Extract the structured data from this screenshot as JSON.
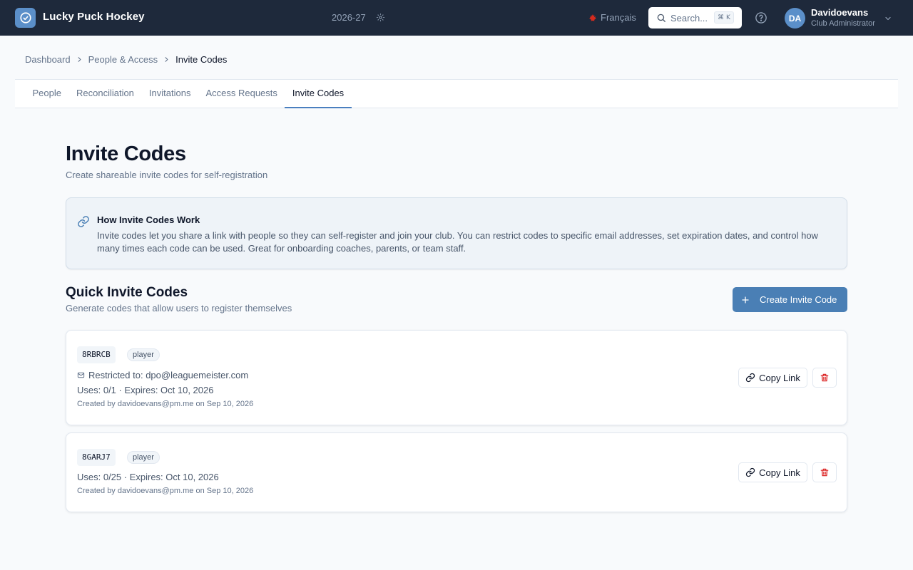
{
  "app": {
    "name": "Lucky Puck Hockey",
    "season": "2026-27"
  },
  "header": {
    "language": "Français",
    "search_placeholder": "Search...",
    "search_shortcut": "⌘ K",
    "user": {
      "initials": "DA",
      "name": "Davidoevans",
      "role": "Club Administrator"
    }
  },
  "breadcrumb": [
    "Dashboard",
    "People & Access",
    "Invite Codes"
  ],
  "tabs": [
    "People",
    "Reconciliation",
    "Invitations",
    "Access Requests",
    "Invite Codes"
  ],
  "page": {
    "title": "Invite Codes",
    "subtitle": "Create shareable invite codes for self-registration"
  },
  "info": {
    "title": "How Invite Codes Work",
    "body": "Invite codes let you share a link with people so they can self-register and join your club. You can restrict codes to specific email addresses, set expiration dates, and control how many times each code can be used. Great for onboarding coaches, parents, or team staff."
  },
  "quick": {
    "title": "Quick Invite Codes",
    "subtitle": "Generate codes that allow users to register themselves",
    "create_label": "Create Invite Code"
  },
  "codes": [
    {
      "code": "8RBRCB",
      "role": "player",
      "restriction": "Restricted to: dpo@leaguemeister.com",
      "uses": "Uses: 0/1 · Expires: Oct 10, 2026",
      "created": "Created by davidoevans@pm.me on Sep 10, 2026",
      "copy_label": "Copy Link"
    },
    {
      "code": "8GARJ7",
      "role": "player",
      "uses": "Uses: 0/25 · Expires: Oct 10, 2026",
      "created": "Created by davidoevans@pm.me on Sep 10, 2026",
      "copy_label": "Copy Link"
    }
  ],
  "colors": {
    "topbar": "#1e293b",
    "accent": "#4a7fb5",
    "danger": "#dc2626",
    "canada_red": "#d52b1e"
  },
  "icons": {
    "logo": "check-circle-icon",
    "season": "gear-icon",
    "search": "search-icon",
    "help": "help-circle-icon",
    "user_menu": "chevron-down-icon",
    "info": "link-icon",
    "create": "plus-icon",
    "restriction": "mail-icon",
    "copy": "link-icon",
    "delete": "trash-icon"
  }
}
